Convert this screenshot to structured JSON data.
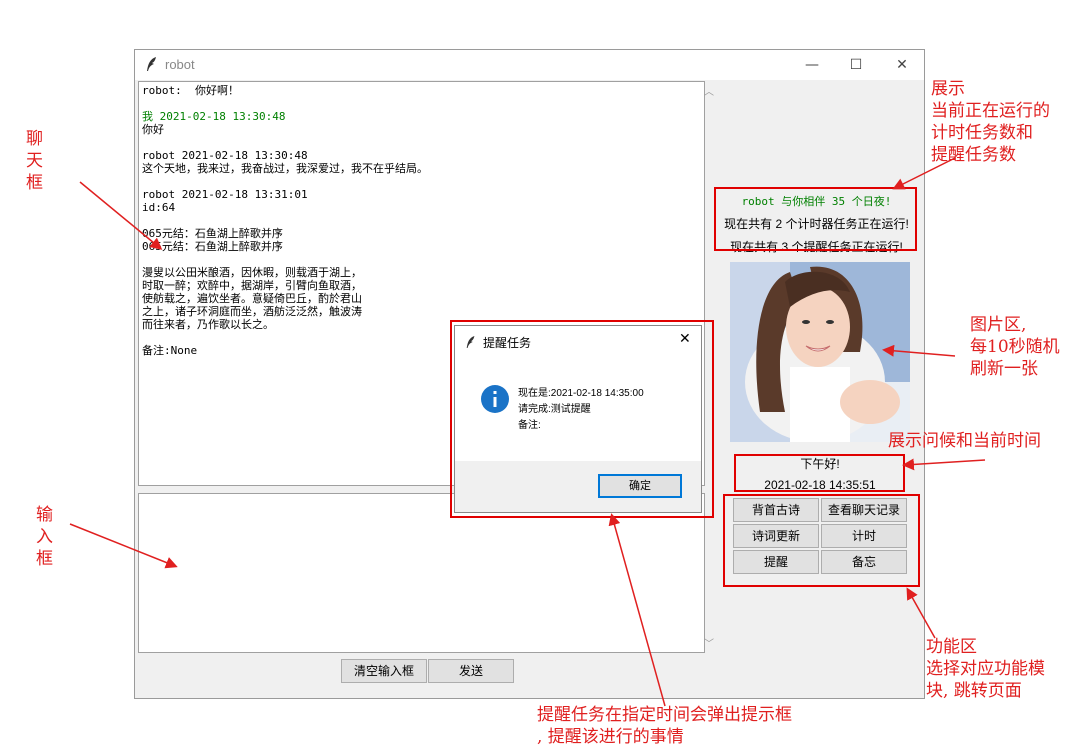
{
  "window": {
    "title": "robot",
    "minimize": "—",
    "maximize": "☐",
    "close": "✕"
  },
  "chat": {
    "lines": [
      {
        "text": "robot:  你好啊！",
        "color": "#000000"
      },
      {
        "text": "",
        "color": "#000000"
      },
      {
        "text": "我 2021-02-18 13:30:48",
        "color": "#008000"
      },
      {
        "text": "你好",
        "color": "#000000"
      },
      {
        "text": "",
        "color": "#000000"
      },
      {
        "text": "robot 2021-02-18 13:30:48",
        "color": "#000000"
      },
      {
        "text": "这个天地，我来过，我奋战过，我深爱过，我不在乎结局。",
        "color": "#000000"
      },
      {
        "text": "",
        "color": "#000000"
      },
      {
        "text": "robot 2021-02-18 13:31:01",
        "color": "#000000"
      },
      {
        "text": "id:64",
        "color": "#000000"
      },
      {
        "text": "",
        "color": "#000000"
      },
      {
        "text": "065元结：石鱼湖上醉歌并序",
        "color": "#000000"
      },
      {
        "text": "065元结：石鱼湖上醉歌并序",
        "color": "#000000"
      },
      {
        "text": "",
        "color": "#000000"
      },
      {
        "text": "漫叟以公田米酿酒，因休暇，则载酒于湖上，",
        "color": "#000000"
      },
      {
        "text": "时取一醉；欢醉中，据湖岸，引臂向鱼取酒，",
        "color": "#000000"
      },
      {
        "text": "使舫载之，遍饮坐者。意疑倚巴丘，酌於君山",
        "color": "#000000"
      },
      {
        "text": "之上，诸子环洞庭而坐，酒舫泛泛然，触波涛",
        "color": "#000000"
      },
      {
        "text": "而往来者，乃作歌以长之。",
        "color": "#000000"
      },
      {
        "text": "",
        "color": "#000000"
      },
      {
        "text": "备注:None",
        "color": "#000000"
      }
    ]
  },
  "bottom_buttons": {
    "clear": "清空输入框",
    "send": "发送"
  },
  "status": {
    "days": "robot 与你相伴 35 个日夜!",
    "timers": "现在共有 2 个计时器任务正在运行!",
    "reminders": "现在共有 3 个提醒任务正在运行!"
  },
  "greeting": {
    "text": "下午好!",
    "time": "2021-02-18 14:35:51"
  },
  "functions": {
    "poem_recite": "背首古诗",
    "chat_history": "查看聊天记录",
    "poem_update": "诗词更新",
    "timer": "计时",
    "remind": "提醒",
    "memo": "备忘"
  },
  "dialog": {
    "title": "提醒任务",
    "line1": "现在是:2021-02-18 14:35:00",
    "line2": "请完成:测试提醒",
    "line3": "备注:",
    "ok": "确定",
    "close": "✕"
  },
  "annotations": {
    "chat_box": [
      "聊",
      "天",
      "框"
    ],
    "input_box": [
      "输",
      "入",
      "框"
    ],
    "status_area": [
      "展示",
      "当前正在运行的",
      "计时任务数和",
      "提醒任务数"
    ],
    "image_area": [
      "图片区,",
      "每10秒随机",
      "刷新一张"
    ],
    "greeting_area": "展示问候和当前时间",
    "function_area": [
      "功能区",
      "选择对应功能模",
      "块, 跳转页面"
    ],
    "dialog_area": [
      "提醒任务在指定时间会弹出提示框",
      ", 提醒该进行的事情"
    ]
  },
  "colors": {
    "annotation": "#e02020",
    "status_green": "#008000",
    "info_icon": "#1a73c7"
  }
}
